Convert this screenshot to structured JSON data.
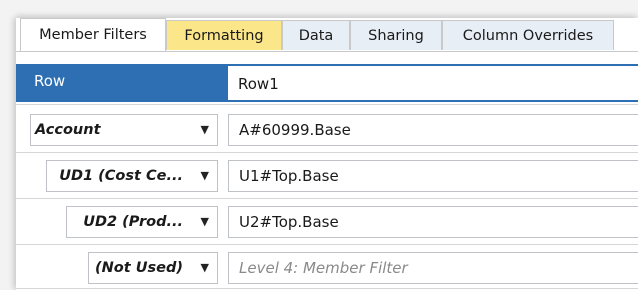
{
  "tabs": [
    {
      "label": "Member Filters",
      "active": true
    },
    {
      "label": "Formatting",
      "highlighted": true
    },
    {
      "label": "Data"
    },
    {
      "label": "Sharing"
    },
    {
      "label": "Column Overrides"
    }
  ],
  "header": {
    "label": "Row",
    "value": "Row1"
  },
  "filters": [
    {
      "dimension": "Account",
      "value": "A#60999.Base",
      "placeholder": ""
    },
    {
      "dimension": "UD1 (Cost Ce...",
      "value": "U1#Top.Base",
      "placeholder": ""
    },
    {
      "dimension": "UD2 (Prod...",
      "value": "U2#Top.Base",
      "placeholder": ""
    },
    {
      "dimension": "(Not Used)",
      "value": "",
      "placeholder": "Level 4: Member Filter"
    }
  ],
  "colors": {
    "header_bg": "#2e6fb3",
    "tab_highlight": "#fbe68a",
    "tab_bg": "#e8eef6"
  }
}
